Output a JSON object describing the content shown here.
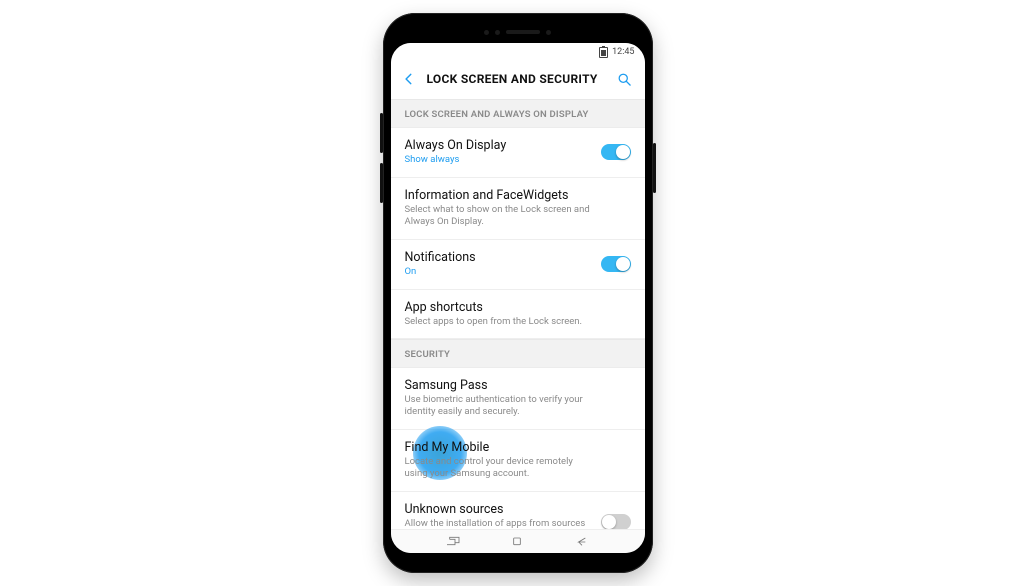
{
  "statusbar": {
    "time": "12:45"
  },
  "appbar": {
    "title": "LOCK SCREEN AND SECURITY"
  },
  "sections": [
    {
      "header": "LOCK SCREEN AND ALWAYS ON DISPLAY",
      "rows": [
        {
          "title": "Always On Display",
          "sub": "Show always",
          "sub_accent": true,
          "toggle": "on"
        },
        {
          "title": "Information and FaceWidgets",
          "sub": "Select what to show on the Lock screen and Always On Display."
        },
        {
          "title": "Notifications",
          "sub": "On",
          "sub_accent": true,
          "toggle": "on"
        },
        {
          "title": "App shortcuts",
          "sub": "Select apps to open from the Lock screen."
        }
      ]
    },
    {
      "header": "SECURITY",
      "rows": [
        {
          "title": "Samsung Pass",
          "sub": "Use biometric authentication to verify your identity easily and securely."
        },
        {
          "title": "Find My Mobile",
          "sub": "Locate and control your device remotely using your Samsung account.",
          "highlighted": true
        },
        {
          "title": "Unknown sources",
          "sub": "Allow the installation of apps from sources other than Play Store or Galaxy Apps.",
          "toggle": "off"
        }
      ]
    }
  ],
  "accent_color": "#1e9df0"
}
